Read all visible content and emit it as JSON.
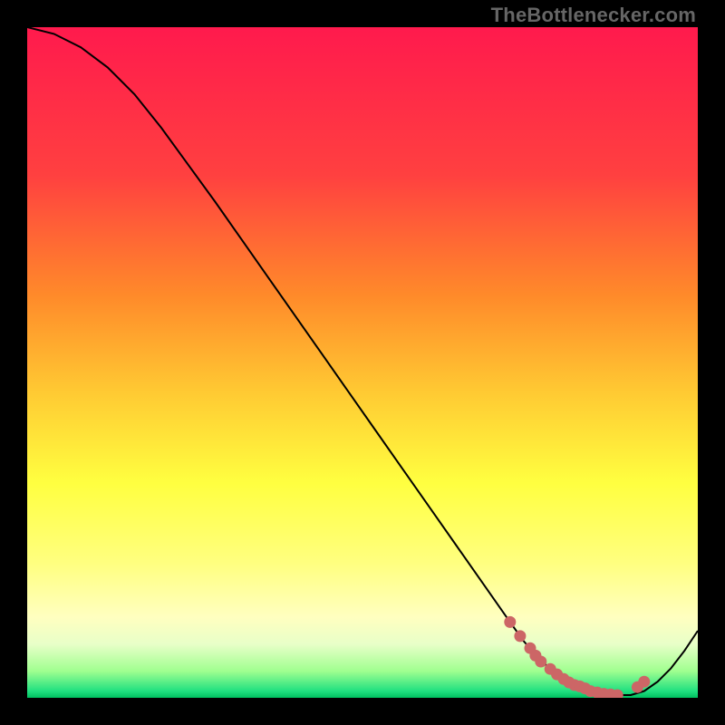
{
  "watermark": "TheBottlenecker.com",
  "chart_data": {
    "type": "line",
    "title": "",
    "xlabel": "",
    "ylabel": "",
    "xlim": [
      0,
      100
    ],
    "ylim": [
      0,
      100
    ],
    "gradient": {
      "stops": [
        {
          "y": 0,
          "color": "#ff1a4d"
        },
        {
          "y": 22,
          "color": "#ff4040"
        },
        {
          "y": 40,
          "color": "#ff8a2a"
        },
        {
          "y": 55,
          "color": "#ffcc33"
        },
        {
          "y": 68,
          "color": "#ffff40"
        },
        {
          "y": 80,
          "color": "#ffff80"
        },
        {
          "y": 88,
          "color": "#ffffc0"
        },
        {
          "y": 92,
          "color": "#e8ffc8"
        },
        {
          "y": 96,
          "color": "#a0ff90"
        },
        {
          "y": 99,
          "color": "#20e080"
        },
        {
          "y": 100,
          "color": "#00c060"
        }
      ]
    },
    "curve": {
      "x": [
        0,
        4,
        8,
        12,
        16,
        20,
        24,
        28,
        32,
        36,
        40,
        44,
        48,
        52,
        56,
        60,
        64,
        68,
        72,
        74,
        76,
        78,
        80,
        82,
        84,
        86,
        88,
        90,
        92,
        94,
        96,
        98,
        100
      ],
      "y": [
        100,
        99,
        97,
        94,
        90,
        85,
        79.5,
        74,
        68.3,
        62.6,
        56.9,
        51.2,
        45.5,
        39.8,
        34.1,
        28.4,
        22.7,
        17,
        11.3,
        8.5,
        6.2,
        4.3,
        2.8,
        1.7,
        1.0,
        0.6,
        0.4,
        0.4,
        1.0,
        2.4,
        4.4,
        7.0,
        10.0
      ]
    },
    "markers": {
      "x": [
        72,
        73.5,
        75,
        75.8,
        76.6,
        78,
        79,
        80,
        80.8,
        81.6,
        82.4,
        83.2,
        84,
        85,
        86,
        87,
        88,
        91,
        92
      ],
      "y": [
        11.3,
        9.2,
        7.4,
        6.3,
        5.4,
        4.3,
        3.5,
        2.8,
        2.3,
        1.9,
        1.7,
        1.4,
        1.0,
        0.8,
        0.6,
        0.5,
        0.4,
        1.6,
        2.4
      ],
      "radius": 6.5,
      "color": "#cc6666"
    }
  }
}
